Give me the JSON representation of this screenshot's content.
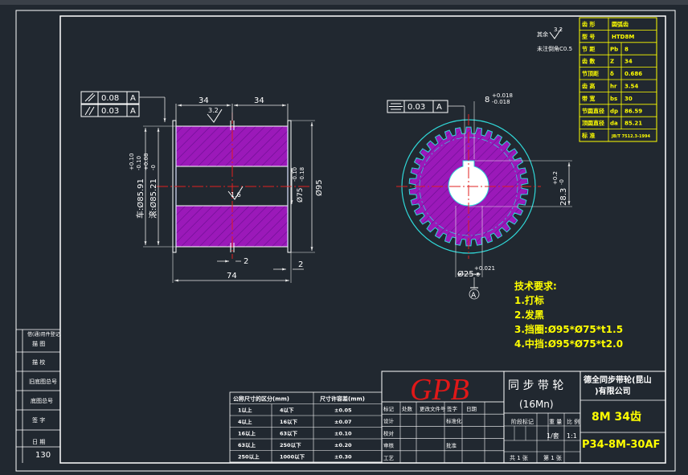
{
  "left_view": {
    "tol_frame_1": {
      "value": "0.08",
      "datum": "A"
    },
    "tol_frame_2": {
      "value": "0.03",
      "datum": "A"
    },
    "dim_left": "34",
    "dim_right": "34",
    "roughness_1": "3.2",
    "roughness_2": "1.6",
    "dim_od_outer": "车:Ø85.91",
    "dim_od_outer_tol": [
      "+0.10",
      "-0.10"
    ],
    "dim_od_inner": "滚:Ø85.21",
    "dim_od_inner_tol": [
      "+0.08",
      "-0"
    ],
    "dim_bore": "Ø75",
    "dim_bore_tol": [
      "-0.10",
      "-0.18"
    ],
    "dim_flange": "Ø95",
    "dim_gap_1": "2",
    "dim_gap_2": "2",
    "dim_total": "74"
  },
  "right_view": {
    "tol_frame": {
      "value": "0.03",
      "datum": "A"
    },
    "keyway": "8",
    "keyway_tol": [
      "+0.018",
      "-0.018"
    ],
    "keyway_depth": "28.3",
    "keyway_depth_tol": [
      "+0.2",
      "-0"
    ],
    "bore": "Ø25",
    "bore_tol": [
      "+0.021",
      "-0"
    ],
    "datum": "A",
    "teeth": 34
  },
  "roughness_note": {
    "label": "其余",
    "value": "3.2",
    "note": "未注倒角C0.5"
  },
  "params_table": [
    [
      "齿  形",
      "圆弧齿"
    ],
    [
      "型  号",
      "HTD8M"
    ],
    [
      "节  距",
      "Pb",
      "8"
    ],
    [
      "齿  数",
      "Z",
      "34"
    ],
    [
      "节顶距",
      "δ",
      "0.686"
    ],
    [
      "齿  高",
      "hr",
      "3.54"
    ],
    [
      "带  宽",
      "bs",
      "30"
    ],
    [
      "节圆直径",
      "dp",
      "86.59"
    ],
    [
      "顶圆直径",
      "da",
      "85.21"
    ],
    [
      "标  准",
      "JB/T 7512.3-1994"
    ]
  ],
  "tech_req": {
    "title": "技术要求:",
    "items": [
      "1.打标",
      "2.发黑",
      "3.挡圈:Ø95*Ø75*t1.5",
      "4.中挡:Ø95*Ø75*t2.0"
    ]
  },
  "left_side_labels": [
    "借(通)用件登记",
    "描  图",
    "描  校",
    "旧底图总号",
    "底图总号",
    "签  字",
    "日  期"
  ],
  "page_number": "130",
  "tolerance_table": {
    "headers": [
      "公称尺寸的区分(mm)",
      "",
      "尺寸许容差(mm)"
    ],
    "rows": [
      [
        "1以上",
        "4以下",
        "±0.05"
      ],
      [
        "4以上",
        "16以下",
        "±0.07"
      ],
      [
        "16以上",
        "63以下",
        "±0.10"
      ],
      [
        "63以上",
        "250以下",
        "±0.20"
      ],
      [
        "250以上",
        "1000以下",
        "±0.30"
      ]
    ]
  },
  "revision_block": {
    "header": [
      "标记",
      "处数",
      "更改文件号",
      "签字",
      "日期"
    ],
    "rows": [
      "设计",
      "校对",
      "审核",
      "工艺"
    ],
    "row_right": [
      "标准化",
      "",
      "批准",
      ""
    ]
  },
  "title_block": {
    "logo": "GPB",
    "part_name": "同 步 带 轮",
    "material": "(16Mn)",
    "company_line1": "德全同步带轮(昆山",
    "company_line2": ")有限公司",
    "spec": "8M  34齿",
    "stage_label": "阶段标记",
    "weight_label": "重 量",
    "scale_label": "比 例",
    "sheet_count": "1/套",
    "scale": "1:1",
    "sheets_total": "共 1 张",
    "sheet_no": "第 1 张",
    "drawing_no": "P34-8M-30AF"
  },
  "colors": {
    "background": "#212830",
    "frame": "#ffffff",
    "hatch": "#9b19b9",
    "hatch_line": "#6a0d90",
    "dim": "#e8e8e8",
    "center": "#e02020",
    "cyan": "#30d8d8",
    "yellow": "#ffff00",
    "logo": "#e01818",
    "blue_edge": "#3050ff"
  }
}
